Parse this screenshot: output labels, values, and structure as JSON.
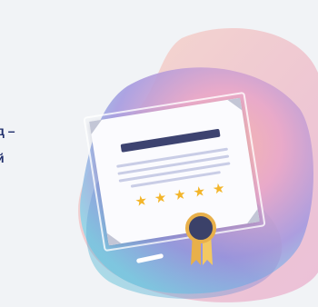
{
  "headline": {
    "line1": "д –",
    "line2": "й"
  },
  "illustration": {
    "stars": [
      "★",
      "★",
      "★",
      "★",
      "★"
    ],
    "colors": {
      "background": "#f1f3f6",
      "headline": "#1f2d6b",
      "star": "#f3b52a",
      "seal": "#3b4169",
      "ribbon": "#e8b04a"
    }
  }
}
